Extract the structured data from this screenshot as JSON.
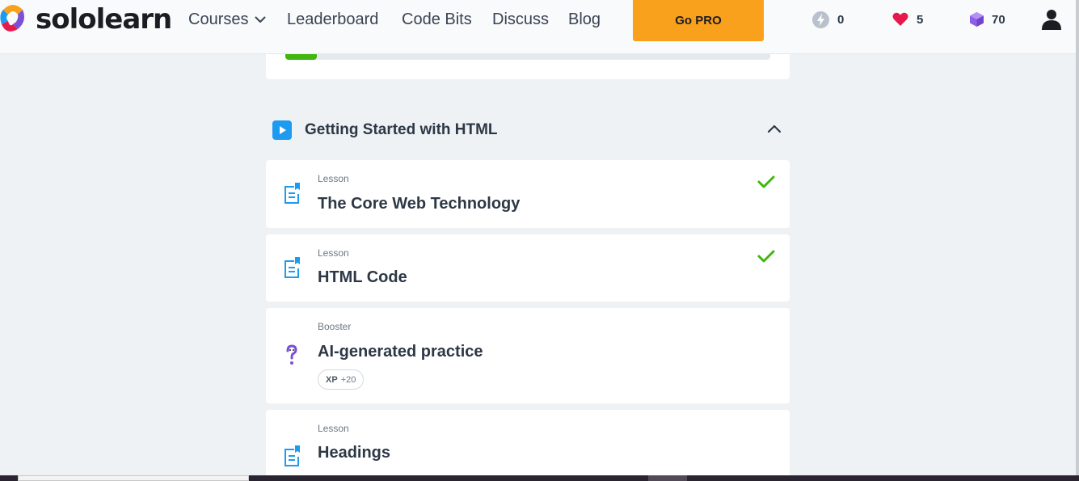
{
  "brand": {
    "name": "sololearn"
  },
  "nav": {
    "courses": "Courses",
    "leaderboard": "Leaderboard",
    "code_bits": "Code Bits",
    "discuss": "Discuss",
    "blog": "Blog",
    "go_pro": "Go PRO"
  },
  "stats": {
    "streak": "0",
    "hearts": "5",
    "gems": "70"
  },
  "progress": {
    "fraction": 0.065
  },
  "module": {
    "title": "Getting Started with HTML",
    "expanded": true
  },
  "items": [
    {
      "kind": "Lesson",
      "title": "The Core Web Technology",
      "completed": true
    },
    {
      "kind": "Lesson",
      "title": "HTML Code",
      "completed": true
    },
    {
      "kind": "Booster",
      "title": "AI-generated practice",
      "xp_label": "XP",
      "xp_value": "+20"
    },
    {
      "kind": "Lesson",
      "title": "Headings"
    }
  ],
  "colors": {
    "accent": "#f9a01c",
    "blue": "#1d9bf0",
    "success": "#3fb70e",
    "heart": "#e5194d",
    "gem": "#8e5ee6",
    "booster": "#7b4fd6"
  }
}
